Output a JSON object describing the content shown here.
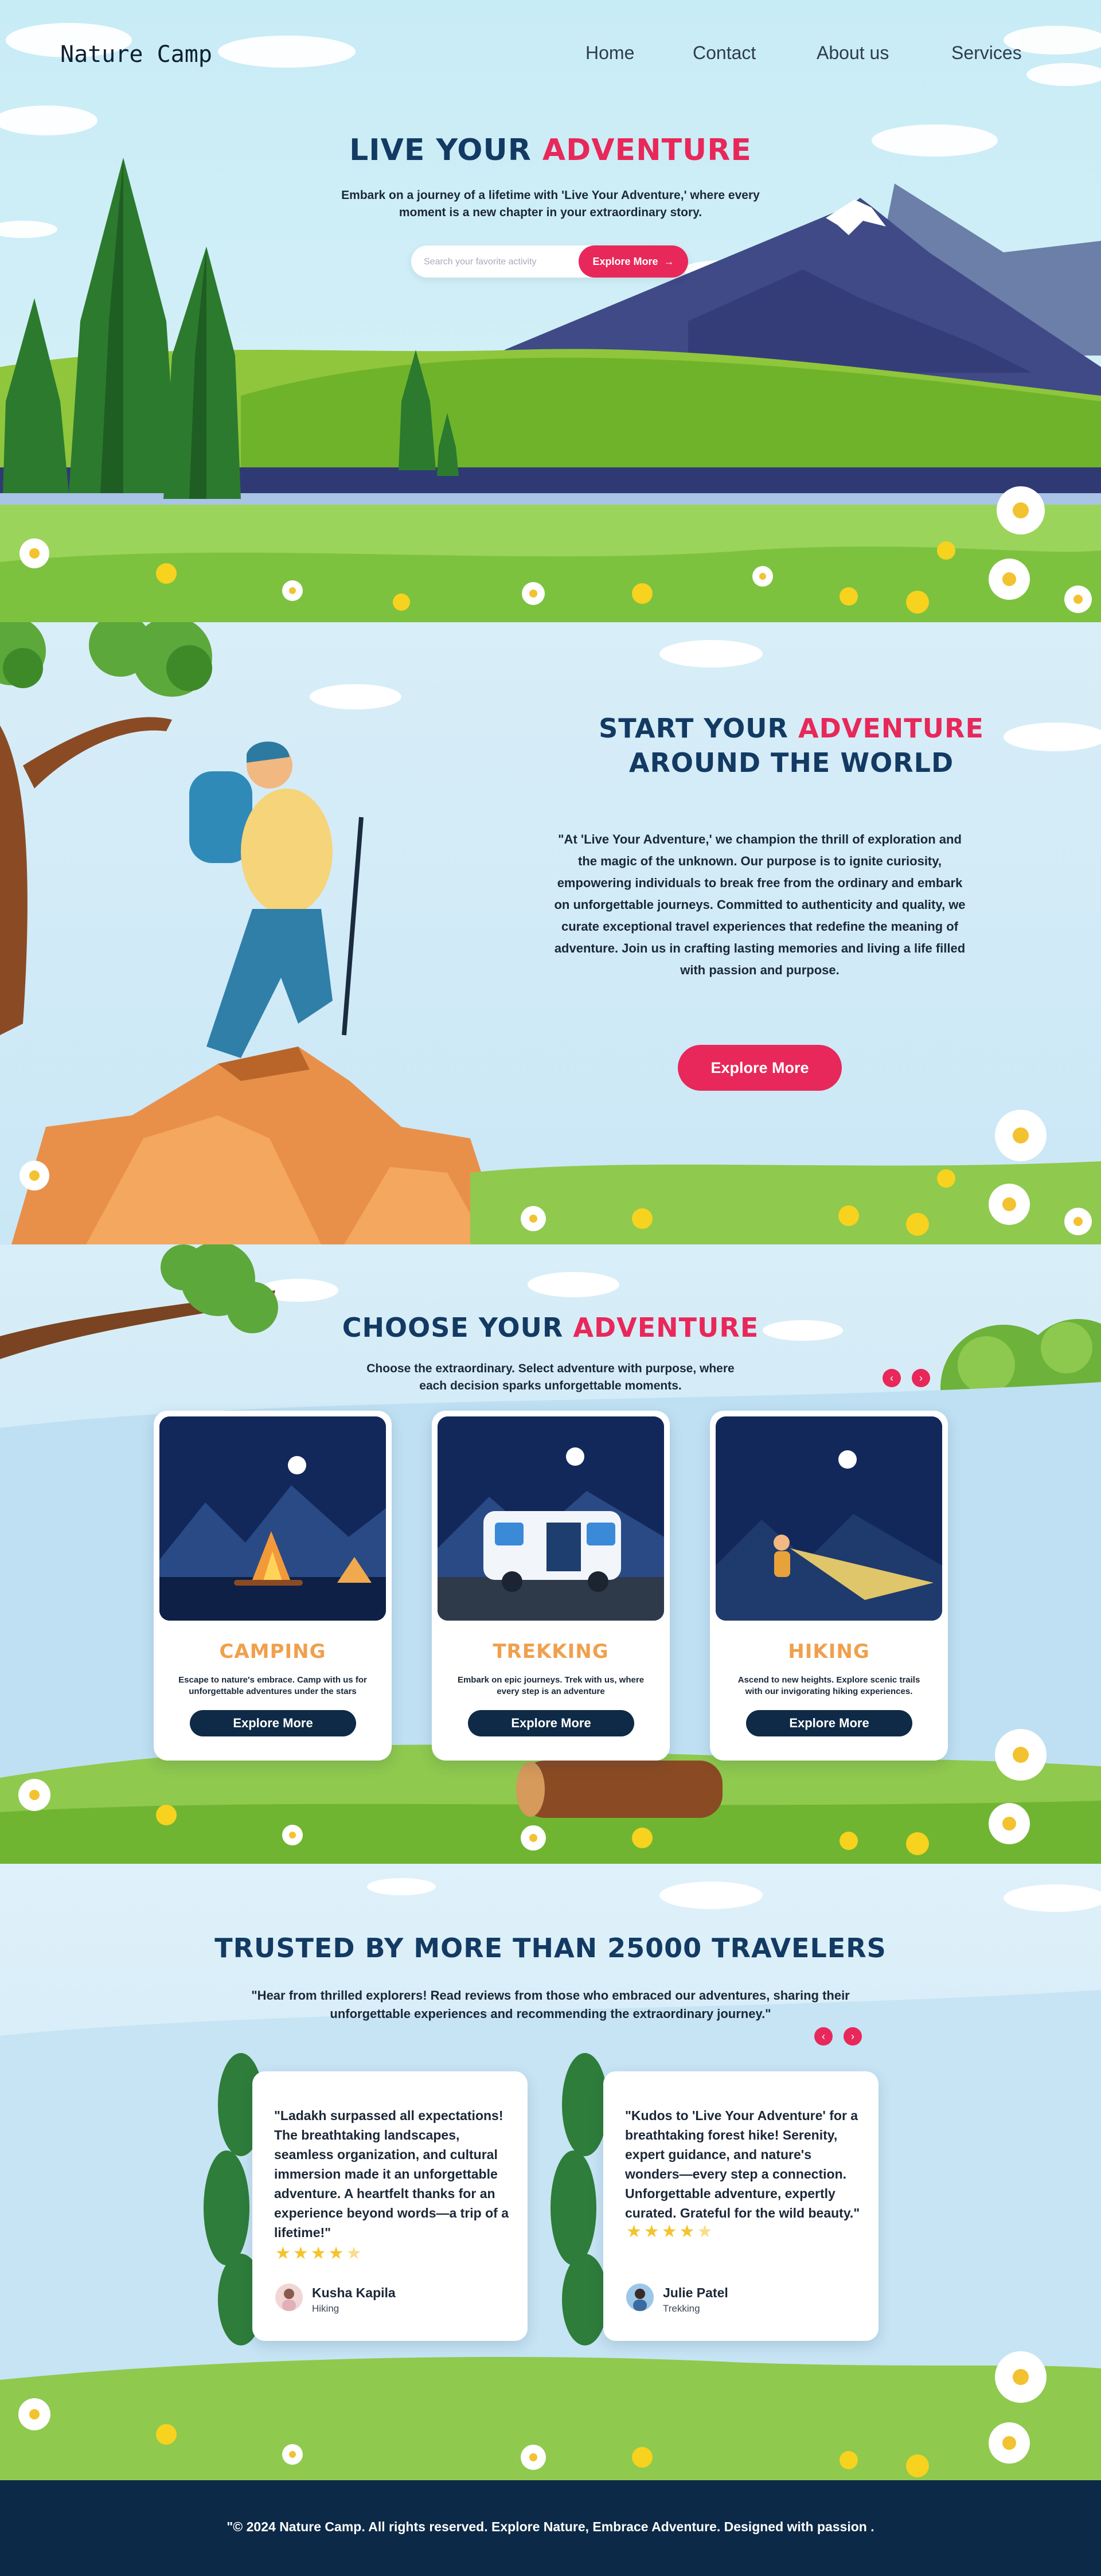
{
  "nav": {
    "logo": "Nature Camp",
    "links": [
      "Home",
      "Contact",
      "About us",
      "Services"
    ]
  },
  "hero": {
    "title_part1": "LIVE YOUR ",
    "title_part2": "ADVENTURE",
    "subtitle": "Embark on a journey of a lifetime with 'Live Your Adventure,' where every moment is a new chapter in your extraordinary story.",
    "search_placeholder": "Search your favorite activity",
    "button_label": "Explore More"
  },
  "about": {
    "title_part1": "START YOUR ",
    "title_part2": "ADVENTURE",
    "title_line2": "AROUND THE WORLD",
    "paragraph": "\"At 'Live Your Adventure,' we champion the thrill of exploration and the magic of the unknown. Our purpose is to ignite curiosity, empowering individuals to break free from the ordinary and embark on unforgettable journeys. Committed to authenticity and quality, we curate exceptional travel experiences that redefine the meaning of adventure. Join us in crafting lasting memories and living a life filled with passion and purpose.",
    "button_label": "Explore More"
  },
  "choose": {
    "title_part1": "CHOOSE YOUR ",
    "title_part2": "ADVENTURE",
    "subtitle": "Choose the extraordinary. Select adventure with purpose, where each decision sparks unforgettable moments.",
    "cards": [
      {
        "title": "CAMPING",
        "desc": "Escape to nature's embrace. Camp with us for unforgettable adventures under the stars",
        "button": "Explore More"
      },
      {
        "title": "TREKKING",
        "desc": "Embark on epic journeys. Trek with us, where every step is an adventure",
        "button": "Explore More"
      },
      {
        "title": "HIKING",
        "desc": "Ascend to new heights. Explore scenic trails with our invigorating hiking experiences.",
        "button": "Explore More"
      }
    ]
  },
  "trusted": {
    "title": "TRUSTED BY MORE THAN 25000 TRAVELERS",
    "subtitle": "\"Hear from thrilled explorers! Read reviews from those who embraced our adventures, sharing their unforgettable experiences and recommending the extraordinary journey.\"",
    "reviews": [
      {
        "quote": "\"Ladakh surpassed all expectations! The breathtaking landscapes, seamless organization, and cultural immersion made it an unforgettable adventure. A heartfelt thanks for an experience beyond words—a trip of a lifetime!\"",
        "rating": 4.5,
        "name": "Kusha Kapila",
        "trip": "Hiking"
      },
      {
        "quote": "\"Kudos to 'Live Your Adventure' for a breathtaking forest hike! Serenity, expert guidance, and nature's wonders—every step a connection. Unforgettable adventure, expertly curated. Grateful for the wild beauty.\"",
        "rating": 4.5,
        "name": "Julie Patel",
        "trip": "Trekking"
      }
    ]
  },
  "footer": {
    "text": "\"© 2024 Nature Camp. All rights reserved. Explore Nature, Embrace Adventure. Designed with passion ."
  },
  "colors": {
    "navy": "#123a63",
    "accent_red": "#e8285a",
    "orange": "#f0a04d",
    "footer_bg": "#0c2a47"
  }
}
